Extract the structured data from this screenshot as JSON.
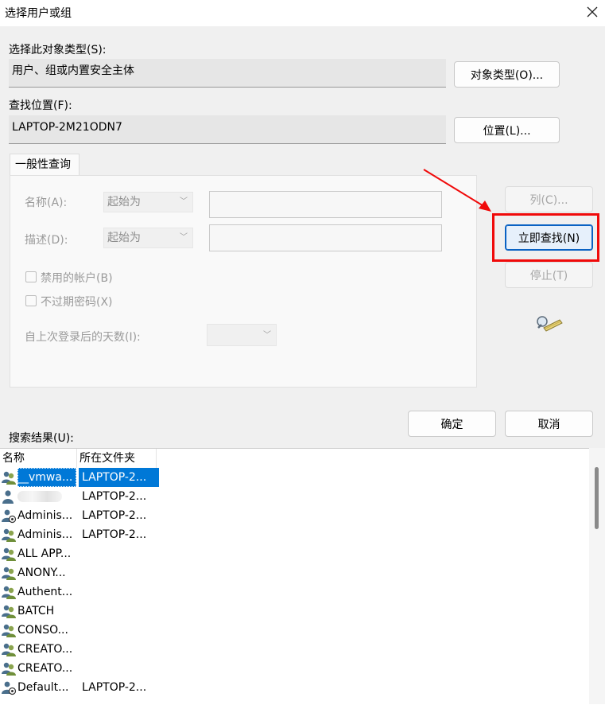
{
  "window": {
    "title": "选择用户或组"
  },
  "object_types": {
    "label": "选择此对象类型(S):",
    "value": "用户、组或内置安全主体",
    "button": "对象类型(O)..."
  },
  "location": {
    "label": "查找位置(F):",
    "value": "LAPTOP-2M21ODN7",
    "button": "位置(L)..."
  },
  "query": {
    "tab": "一般性查询",
    "name_label": "名称(A):",
    "name_mode": "起始为",
    "desc_label": "描述(D):",
    "desc_mode": "起始为",
    "disabled_accounts": "禁用的帐户(B)",
    "non_expiring": "不过期密码(X)",
    "days_label": "自上次登录后的天数(I):"
  },
  "side_buttons": {
    "columns": "列(C)...",
    "find_now": "立即查找(N)",
    "stop": "停止(T)"
  },
  "ok": "确定",
  "cancel": "取消",
  "results": {
    "label": "搜索结果(U):",
    "columns": [
      "名称",
      "所在文件夹"
    ],
    "rows": [
      {
        "name": "__vmwa...",
        "folder": "LAPTOP-2...",
        "icon": "user-icon",
        "selected": true
      },
      {
        "name": "",
        "folder": "LAPTOP-2...",
        "icon": "single-user-icon",
        "blurred": true
      },
      {
        "name": "Adminis...",
        "folder": "LAPTOP-2...",
        "icon": "admin-user-icon"
      },
      {
        "name": "Adminis...",
        "folder": "LAPTOP-2...",
        "icon": "group-icon"
      },
      {
        "name": "ALL APP...",
        "folder": "",
        "icon": "group-icon"
      },
      {
        "name": "ANONY...",
        "folder": "",
        "icon": "group-icon"
      },
      {
        "name": "Authent...",
        "folder": "",
        "icon": "group-icon"
      },
      {
        "name": "BATCH",
        "folder": "",
        "icon": "group-icon"
      },
      {
        "name": "CONSO...",
        "folder": "",
        "icon": "group-icon"
      },
      {
        "name": "CREATO...",
        "folder": "",
        "icon": "group-icon"
      },
      {
        "name": "CREATO...",
        "folder": "",
        "icon": "group-icon"
      },
      {
        "name": "Default...",
        "folder": "LAPTOP-2...",
        "icon": "admin-user-icon"
      }
    ]
  },
  "colors": {
    "accent": "#0078d7",
    "annotation": "#f00a0a"
  }
}
